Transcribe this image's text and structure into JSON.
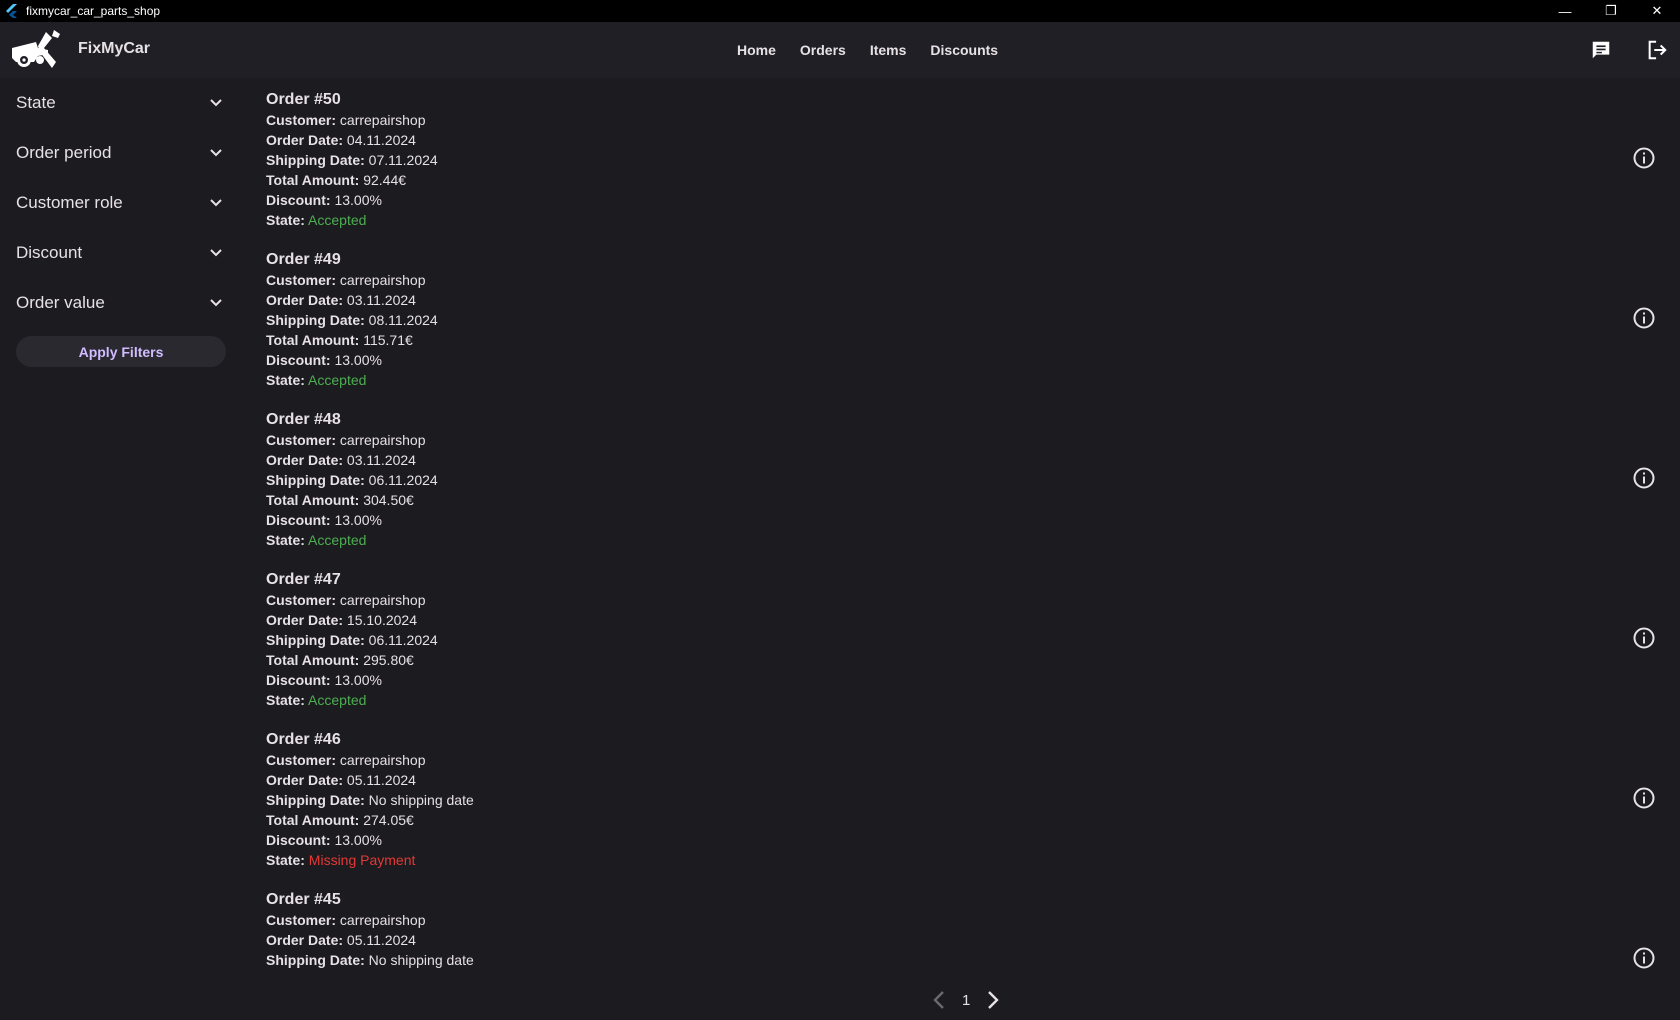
{
  "window": {
    "title": "fixmycar_car_parts_shop"
  },
  "appbar": {
    "brand": "FixMyCar",
    "nav": [
      "Home",
      "Orders",
      "Items",
      "Discounts"
    ]
  },
  "sidebar": {
    "filters": [
      "State",
      "Order period",
      "Customer role",
      "Discount",
      "Order value"
    ],
    "apply_label": "Apply Filters"
  },
  "labels": {
    "customer": "Customer:",
    "order_date": "Order Date:",
    "shipping_date": "Shipping Date:",
    "total_amount": "Total Amount:",
    "discount": "Discount:",
    "state": "State:"
  },
  "orders": [
    {
      "title": "Order #50",
      "customer": "carrepairshop",
      "order_date": "04.11.2024",
      "shipping_date": "07.11.2024",
      "total": "92.44€",
      "discount": "13.00%",
      "state": "Accepted"
    },
    {
      "title": "Order #49",
      "customer": "carrepairshop",
      "order_date": "03.11.2024",
      "shipping_date": "08.11.2024",
      "total": "115.71€",
      "discount": "13.00%",
      "state": "Accepted"
    },
    {
      "title": "Order #48",
      "customer": "carrepairshop",
      "order_date": "03.11.2024",
      "shipping_date": "06.11.2024",
      "total": "304.50€",
      "discount": "13.00%",
      "state": "Accepted"
    },
    {
      "title": "Order #47",
      "customer": "carrepairshop",
      "order_date": "15.10.2024",
      "shipping_date": "06.11.2024",
      "total": "295.80€",
      "discount": "13.00%",
      "state": "Accepted"
    },
    {
      "title": "Order #46",
      "customer": "carrepairshop",
      "order_date": "05.11.2024",
      "shipping_date": "No shipping date",
      "total": "274.05€",
      "discount": "13.00%",
      "state": "Missing Payment"
    },
    {
      "title": "Order #45",
      "customer": "carrepairshop",
      "order_date": "05.11.2024",
      "shipping_date": "No shipping date",
      "total": "",
      "discount": "",
      "state": ""
    }
  ],
  "pagination": {
    "page": "1"
  },
  "colors": {
    "accepted": "#4caf50",
    "missing_payment": "#e53935",
    "accent": "#d0bcff"
  },
  "icons": {
    "chat": "chat-icon",
    "logout": "logout-icon",
    "info": "info-icon",
    "expand": "chevron-down-icon"
  }
}
